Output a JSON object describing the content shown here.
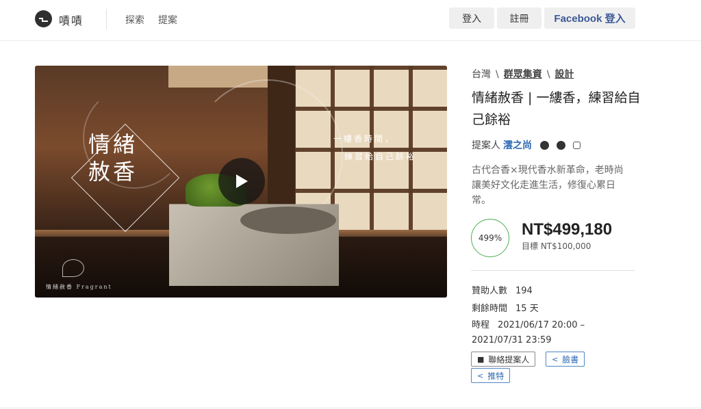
{
  "header": {
    "brand": "嘖嘖",
    "nav": [
      "探索",
      "提案"
    ],
    "login_label": "登入",
    "register_label": "註冊",
    "facebook_label": "Facebook 登入"
  },
  "hero": {
    "title_line1": "情緒",
    "title_line2": "赦香",
    "slogan_line1": "一縷香時間，",
    "slogan_line2": "練習給自己餘裕",
    "brand_small": "情緒赦香  Fragrant"
  },
  "project": {
    "breadcrumb": {
      "location": "台灣",
      "type": "群眾集資",
      "category": "設計",
      "separator": "\\"
    },
    "title": "情緒赦香 | 一縷香，練習給自己餘裕",
    "owner_label": "提案人",
    "owner_name": "澐之尚",
    "description": "古代合香×現代香水新革命，老時尚讓美好文化走進生活，修復心累日常。",
    "percent": "499%",
    "amount": "NT$499,180",
    "goal": "目標 NT$100,000",
    "stats": {
      "backers_label": "贊助人數",
      "backers_value": "194",
      "remaining_label": "剩餘時間",
      "remaining_value": "15 天",
      "period_label": "時程",
      "period_value": "2021/06/17 20:00 – 2021/07/31 23:59"
    },
    "actions": {
      "contact_label": "聯絡提案人",
      "facebook_label": "臉書",
      "twitter_label": "推特"
    }
  },
  "colors": {
    "link_blue": "#2d6ab3",
    "facebook_blue": "#3b5998",
    "progress_green": "#4caf50"
  }
}
